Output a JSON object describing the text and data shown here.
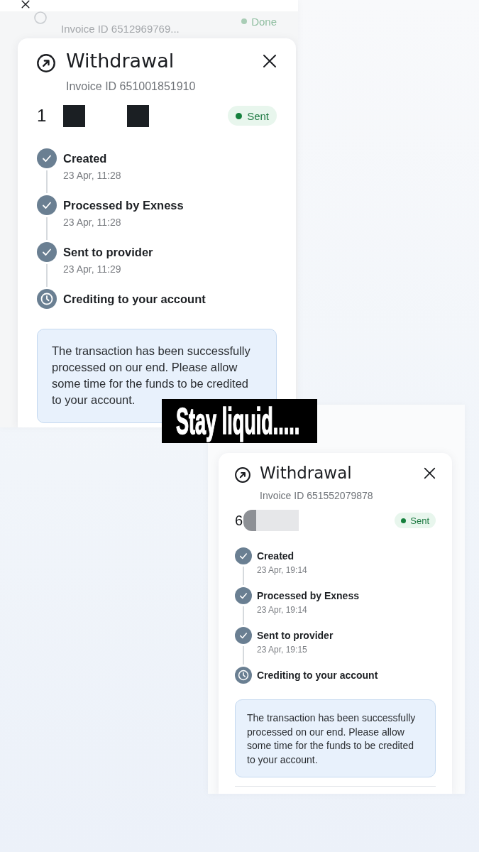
{
  "screenshots": [
    {
      "background_item": {
        "invoice_id": "Invoice ID 6512969769...",
        "status": "Done"
      },
      "modal": {
        "title": "Withdrawal",
        "invoice_id": "Invoice ID 651001851910",
        "amount": "1",
        "status": "Sent",
        "steps": [
          {
            "kind": "done",
            "title": "Created",
            "time": "23 Apr, 11:28"
          },
          {
            "kind": "done",
            "title": "Processed by Exness",
            "time": "23 Apr, 11:28"
          },
          {
            "kind": "done",
            "title": "Sent to provider",
            "time": "23 Apr, 11:29"
          },
          {
            "kind": "pending",
            "title": "Crediting to your account"
          }
        ],
        "notice": "The transaction has been successfully processed on our end. Please allow some time for the funds to be credited to your account."
      }
    },
    {
      "modal": {
        "title": "Withdrawal",
        "invoice_id": "Invoice ID 651552079878",
        "amount": "6",
        "status": "Sent",
        "steps": [
          {
            "kind": "done",
            "title": "Created",
            "time": "23 Apr, 19:14"
          },
          {
            "kind": "done",
            "title": "Processed by Exness",
            "time": "23 Apr, 19:14"
          },
          {
            "kind": "done",
            "title": "Sent to provider",
            "time": "23 Apr, 19:15"
          },
          {
            "kind": "pending",
            "title": "Crediting to your account"
          }
        ],
        "notice": "The transaction has been successfully processed on our end. Please allow some time for the funds to be credited to your account."
      }
    }
  ],
  "caption": "Stay liquid....."
}
